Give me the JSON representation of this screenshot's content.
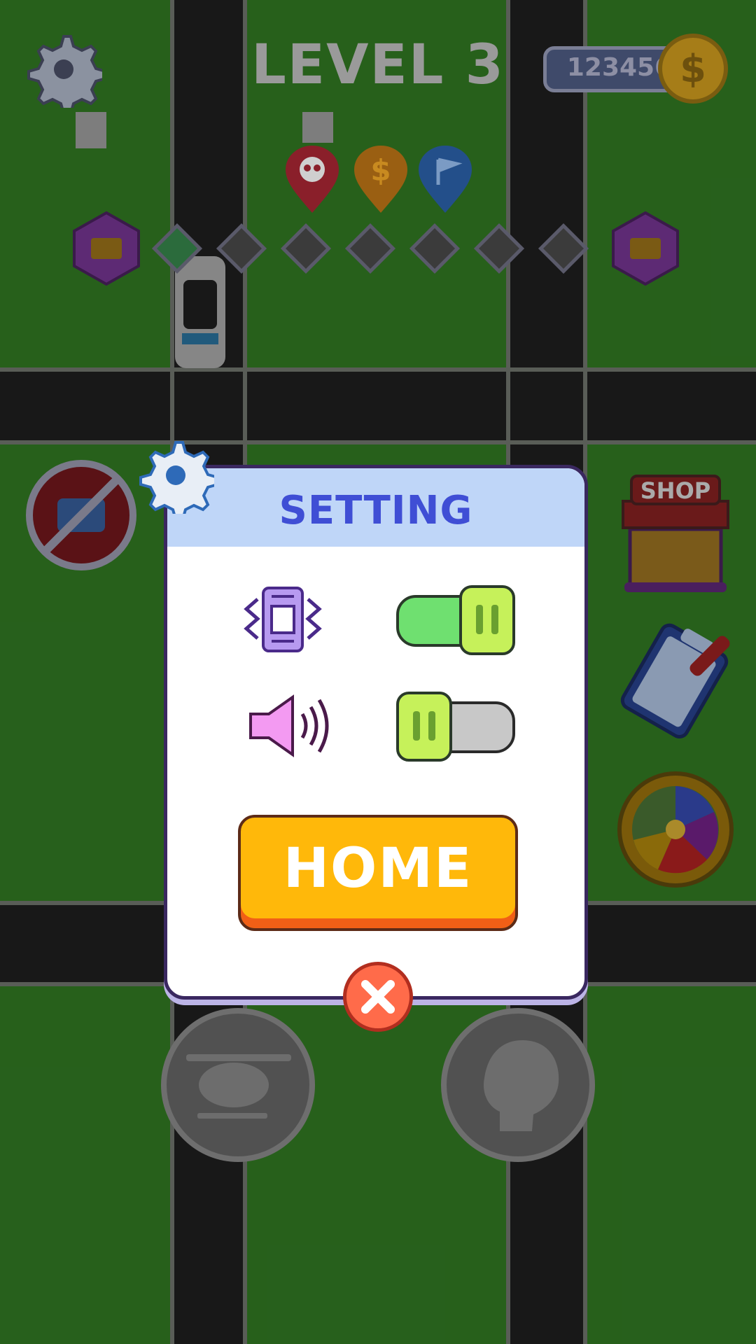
{
  "hud": {
    "level_title": "LEVEL 3",
    "coins": "123456"
  },
  "progress": {
    "markers": [
      "skull",
      "dollar",
      "flag"
    ],
    "stages_total": 7,
    "stages_completed": 1
  },
  "modal": {
    "title": "SETTING",
    "vibration_enabled": true,
    "sound_enabled": false,
    "home_label": "HOME"
  },
  "shop": {
    "label": "SHOP"
  },
  "colors": {
    "accent_title": "#3f4ed5",
    "home_button": "#ffb80a",
    "toggle_on": "#6fe070",
    "close": "#ff6b4a"
  }
}
